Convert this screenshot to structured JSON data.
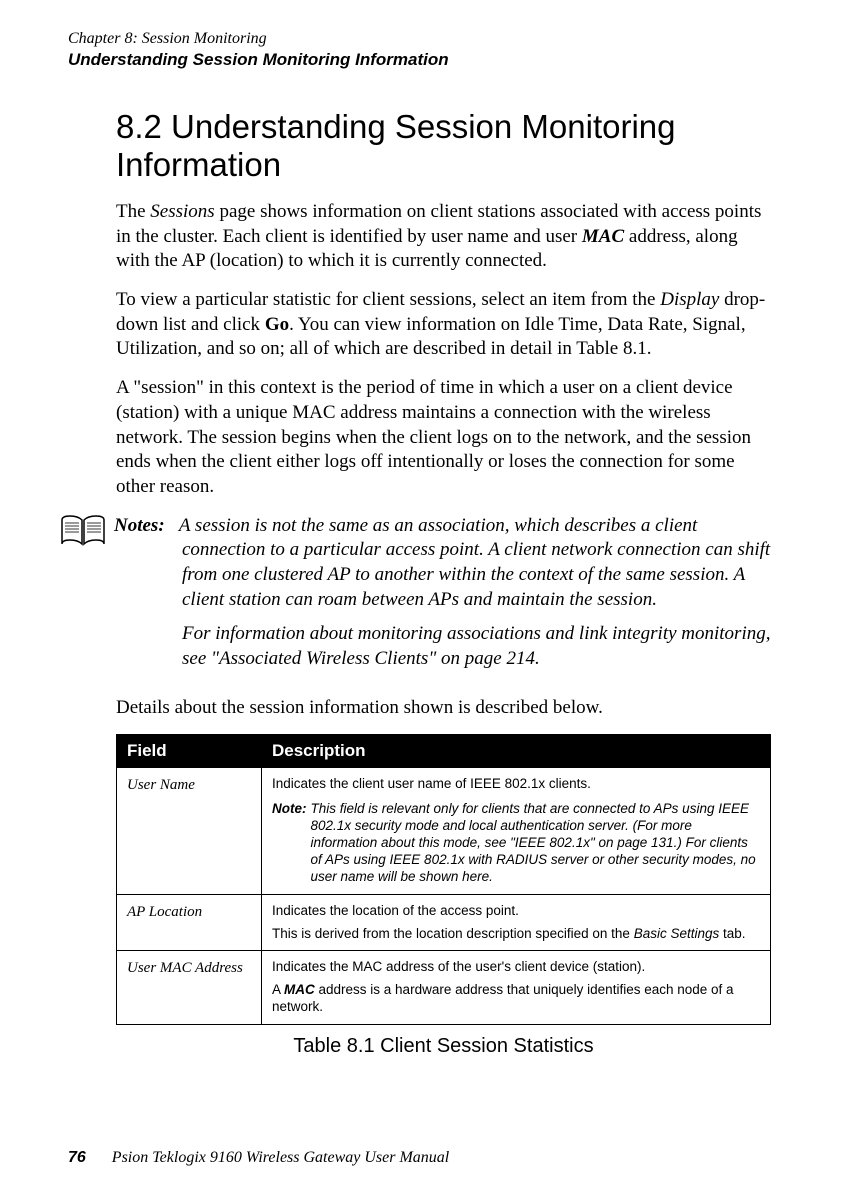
{
  "header": {
    "chapter": "Chapter 8:  Session Monitoring",
    "section": "Understanding Session Monitoring Information"
  },
  "heading": "8.2   Understanding Session Monitoring Information",
  "para1_pre": "The ",
  "para1_sessions": "Sessions",
  "para1_mid": " page shows information on client stations associated with access points in the cluster. Each client is identified by user name and user ",
  "para1_mac": "MAC",
  "para1_post": " address, along with the AP (location) to which it is currently connected.",
  "para2_pre": "To view a particular statistic for client sessions, select an item from the ",
  "para2_display": "Display",
  "para2_mid": " drop-down list and click ",
  "para2_go": "Go",
  "para2_post": ". You can view information on Idle Time, Data Rate, Signal, Utilization, and so on; all of which are described in detail in Table 8.1.",
  "para3": "A \"session\" in this context is the period of time in which a user on a client device (station) with a unique MAC address maintains a connection with the wireless network. The session begins when the client logs on to the network, and the session ends when the client either logs off intentionally or loses the connection for some other reason.",
  "notes": {
    "label": "Notes:",
    "text1": "A session is not the same as an association, which describes a client connection to a particular access point. A client network connection can shift from one clustered AP to another within the context of the same session. A client station can roam between APs and maintain the session.",
    "text2": "For information about monitoring associations and link integrity monitoring, see \"Associated Wireless Clients\" on page 214."
  },
  "para4": "Details about the session information shown is described below.",
  "table": {
    "header_field": "Field",
    "header_desc": "Description",
    "rows": [
      {
        "field": "User Name",
        "desc_main": "Indicates the client user name of IEEE 802.1x clients.",
        "note_label": "Note:",
        "note_body": "This field is relevant only for clients that are connected to APs using IEEE 802.1x security mode and local authentication server. (For more information about this mode, see \"IEEE 802.1x\" on page 131.) For clients of APs using IEEE 802.1x with RADIUS server or other security modes, no user name will be shown here."
      },
      {
        "field": "AP Location",
        "desc_line1": "Indicates the location of the access point.",
        "desc_line2_pre": "This is derived from the location description specified on the ",
        "desc_line2_basic": "Basic Settings",
        "desc_line2_post": " tab."
      },
      {
        "field": "User MAC Address",
        "desc_line1": "Indicates the MAC address of the user's client device (station).",
        "desc_line2_pre": "A ",
        "desc_line2_mac": "MAC",
        "desc_line2_post": " address is a hardware address that uniquely identifies each node of a network."
      }
    ],
    "caption": "Table 8.1 Client Session Statistics"
  },
  "footer": {
    "page": "76",
    "text": "Psion Teklogix 9160 Wireless Gateway User Manual"
  }
}
